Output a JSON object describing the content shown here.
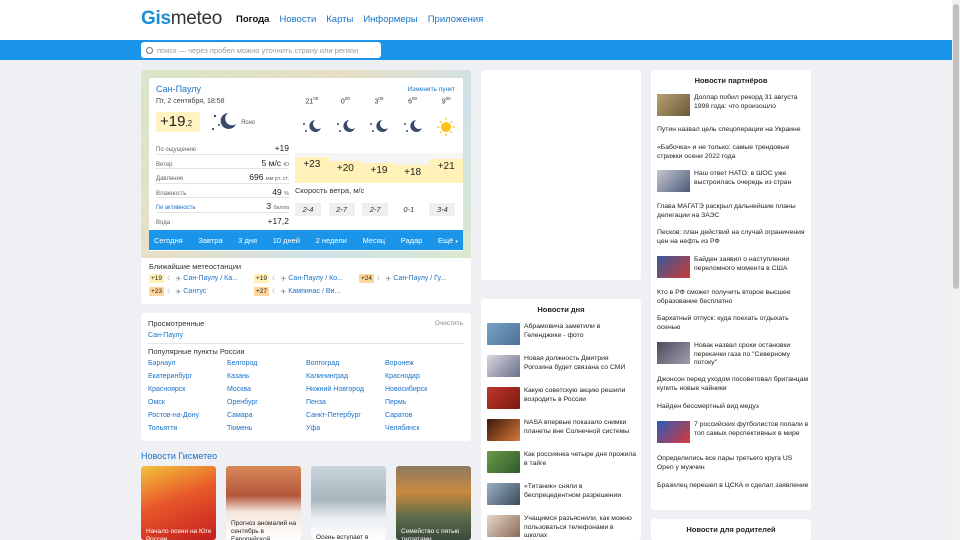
{
  "header": {
    "logo_part1": "Gis",
    "logo_part2": "meteo",
    "nav": [
      "Погода",
      "Новости",
      "Карты",
      "Информеры",
      "Приложения"
    ]
  },
  "search": {
    "placeholder": "поиск — через пробел можно уточнить страну или регион"
  },
  "weather": {
    "city": "Сан-Паулу",
    "change_link": "Изменить пункт",
    "datetime": "Пт, 2 сентября, 18:58",
    "temp_main": "+19",
    "temp_decimal": ",2",
    "sky": "Ясно",
    "params": [
      {
        "label": "По ощущению",
        "value": "+19",
        "unit": ""
      },
      {
        "label": "Ветер",
        "value": "5 м/с",
        "unit": "Ю"
      },
      {
        "label": "Давление",
        "value": "696",
        "unit": "мм рт. ст."
      },
      {
        "label": "Влажность",
        "value": "49",
        "unit": "%"
      },
      {
        "label": "Гм активность",
        "value": "3",
        "unit": "балла"
      },
      {
        "label": "Вода",
        "value": "+17,2",
        "unit": ""
      }
    ],
    "forecast": [
      {
        "hour": "21",
        "min": "00",
        "temp": "+23",
        "icon": "moon-stars-icon"
      },
      {
        "hour": "0",
        "min": "00",
        "temp": "+20",
        "icon": "moon-stars-icon"
      },
      {
        "hour": "3",
        "min": "00",
        "temp": "+19",
        "icon": "moon-stars-icon"
      },
      {
        "hour": "6",
        "min": "00",
        "temp": "+18",
        "icon": "moon-stars-icon"
      },
      {
        "hour": "9",
        "min": "00",
        "temp": "+21",
        "icon": "sun-icon"
      }
    ],
    "wind_label": "Скорость ветра, м/с",
    "winds": [
      "2-4",
      "2-7",
      "2-7",
      "0-1",
      "3-4"
    ],
    "tabs": [
      "Сегодня",
      "Завтра",
      "3 дня",
      "10 дней",
      "2 недели",
      "Месяц",
      "Радар",
      "Ещё"
    ]
  },
  "stations": {
    "title": "Ближайшие метеостанции",
    "items": [
      {
        "temp": "+19",
        "name": "Сан-Паулу / Ка...",
        "icon": "moon-icon"
      },
      {
        "temp": "+19",
        "name": "Сан-Паулу / Ко...",
        "icon": "plane-icon"
      },
      {
        "temp": "+24",
        "name": "Сан-Паулу / Гу...",
        "icon": "plane-icon"
      },
      {
        "temp": "+23",
        "name": "Сантус",
        "icon": "plane-icon"
      },
      {
        "temp": "+27",
        "name": "Кампинас / Ви...",
        "icon": "plane-icon"
      }
    ]
  },
  "viewed": {
    "title": "Просмотренные",
    "clear": "Очистить",
    "items": [
      "Сан-Паулу"
    ],
    "popular_title": "Популярные пункты России",
    "cities": [
      "Барнаул",
      "Белгород",
      "Волгоград",
      "Воронеж",
      "Екатеринбург",
      "Казань",
      "Калининград",
      "Краснодар",
      "Красноярск",
      "Москва",
      "Нижний Новгород",
      "Новосибирск",
      "Омск",
      "Оренбург",
      "Пенза",
      "Пермь",
      "Ростов-на-Дону",
      "Самара",
      "Санкт-Петербург",
      "Саратов",
      "Тольятти",
      "Тюмень",
      "Уфа",
      "Челябинск"
    ]
  },
  "gismeteo_news": {
    "title": "Новости Гисметео",
    "items": [
      {
        "caption": "Начало осени на Юге России"
      },
      {
        "caption": "Прогноз аномалий на сентябрь в Европейской"
      },
      {
        "caption": "Осень вступает в свои"
      },
      {
        "caption": "Семейство с пятью тигрятами"
      }
    ]
  },
  "news_day": {
    "title": "Новости дня",
    "items": [
      "Абрамовича заметили в Геленджике - фото",
      "Новая должность Дмитрия Рогозина будет связана со СМИ",
      "Какую советскую акцию решили возродить в России",
      "NASA впервые показало снимки планеты вне Солнечной системы",
      "Как россиянка четыре дня прожила в тайге",
      "«Титаник» сняли в беспрецедентном разрешении",
      "Учащимся разъяснили, как можно пользоваться телефонами в школах"
    ]
  },
  "partners": {
    "title": "Новости партнёров",
    "items": [
      "Доллар побил рекорд 31 августа 1998 года: что произошло",
      "Путин назвал цель спецоперации на Украине",
      "«Бабочка» и не только: самые трендовые стрижки осени 2022 года",
      "Наш ответ НАТО: в ШОС уже выстроилась очередь из стран",
      "Глава МАГАТЭ раскрыл дальнейшие планы делегации на ЗАЭС",
      "Песков: план действий на случай ограничения цен на нефть из РФ",
      "Байден заявил о наступлении переломного момента в США",
      "Кто в РФ сможет получить второе высшее образование бесплатно",
      "Бархатный отпуск: куда поехать отдыхать осенью",
      "Новак назвал сроки остановки перекачки газа по \"Северному потоку\"",
      "Джонсон перед уходом посоветовал британцам купить новые чайники",
      "Найден бессмертный вид медуз",
      "7 российских футболистов попали в топ самых перспективных в мире",
      "Определились все пары третьего круга US Open у мужчин",
      "Бразилец перешел в ЦСКА и сделал заявление"
    ]
  },
  "parents": {
    "title": "Новости для родителей"
  },
  "colors": {
    "accent": "#1a95ea",
    "link": "#1a73c7",
    "temp_bg": "#fff1b8"
  }
}
